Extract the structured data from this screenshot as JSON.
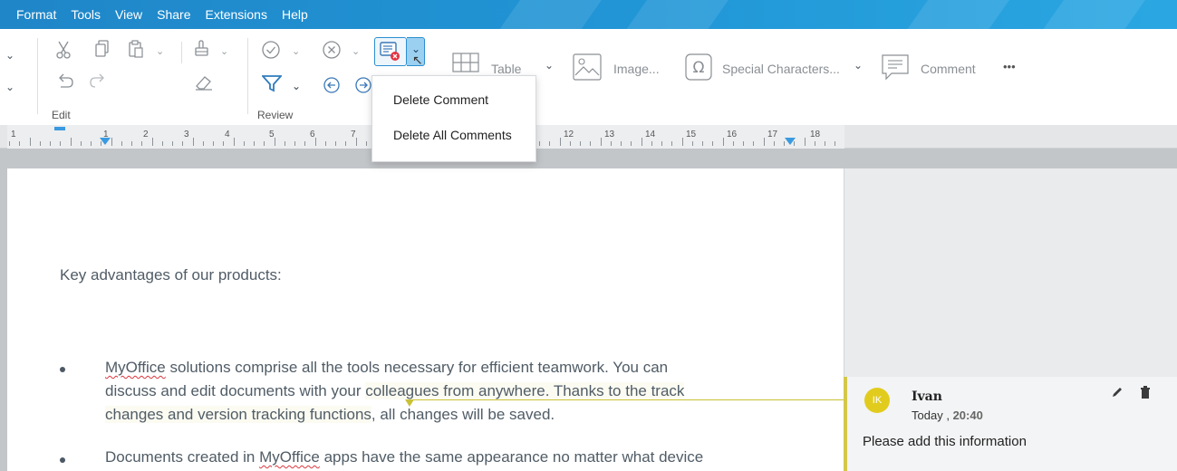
{
  "menu": {
    "items": [
      "Format",
      "Tools",
      "View",
      "Share",
      "Extensions",
      "Help"
    ]
  },
  "toolbar": {
    "groups": {
      "edit_label": "Edit",
      "review_label": "Review"
    },
    "insert": {
      "table_label": "Table",
      "image_label": "Image...",
      "special_chars_label": "Special Characters...",
      "comment_label": "Comment",
      "more_label": "•••"
    }
  },
  "dropdown": {
    "delete_comment": "Delete Comment",
    "delete_all_comments": "Delete All Comments"
  },
  "ruler": {
    "numbers": [
      "1",
      "1",
      "2",
      "3",
      "4",
      "5",
      "6",
      "7",
      "12",
      "13",
      "14",
      "15",
      "16",
      "17",
      "18"
    ]
  },
  "document": {
    "heading": "Key advantages of our products:",
    "bullet1": {
      "brand": "MyOffice",
      "line1_rest": " solutions comprise all the tools necessary for efficient teamwork. You can",
      "line2_before": "discuss and edit documents with your ",
      "line2_highlight": "colleagues from anywhere. Thanks to the track",
      "line3_highlight": "changes and version tracking functions",
      "line3_after": ", all changes will be saved."
    },
    "bullet2": {
      "before": "Documents created in ",
      "brand": "MyOffice",
      "after": " apps have the same appearance no matter what device"
    }
  },
  "comment": {
    "initials": "IK",
    "author": "Ivan",
    "day": "Today",
    "separator": ",",
    "time": "20:40",
    "text": "Please add this information"
  },
  "colors": {
    "menubar": "#2196d6",
    "accent": "#2b8fd0",
    "comment_accent": "#d3c84a",
    "avatar": "#e1cc1e"
  }
}
